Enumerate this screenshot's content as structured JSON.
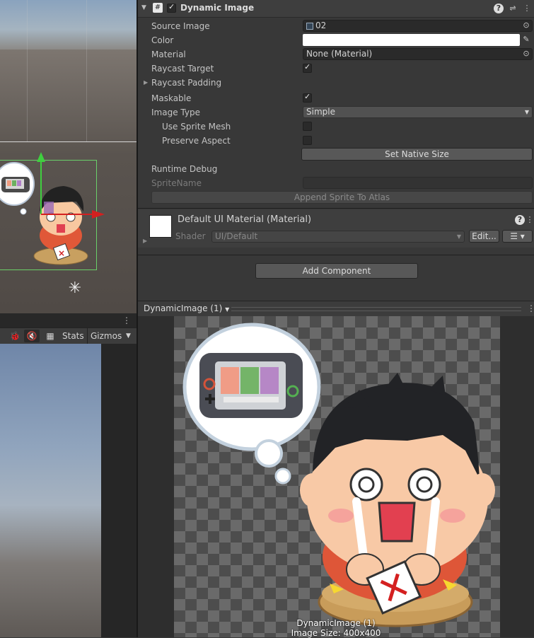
{
  "scene": {
    "icons": {
      "move_handle": "move-gizmo-icon",
      "rect_tool": "rect-tool-icon"
    }
  },
  "game_toolbar": {
    "stats_label": "Stats",
    "gizmos_label": "Gizmos",
    "icons": [
      "bug-icon",
      "mute-audio-icon",
      "grid-icon",
      "dropdown-arrow-icon"
    ]
  },
  "inspector": {
    "component_title": "Dynamic Image",
    "component_enabled": true,
    "header_icons": [
      "help-icon",
      "presets-icon",
      "more-icon"
    ],
    "rows": {
      "source_image": {
        "label": "Source Image",
        "value": "02"
      },
      "color": {
        "label": "Color",
        "value": "#ffffff"
      },
      "material": {
        "label": "Material",
        "value": "None (Material)"
      },
      "raycast_target": {
        "label": "Raycast Target",
        "checked": true
      },
      "raycast_padding": {
        "label": "Raycast Padding"
      },
      "maskable": {
        "label": "Maskable",
        "checked": true
      },
      "image_type": {
        "label": "Image Type",
        "value": "Simple"
      },
      "use_sprite_mesh": {
        "label": "Use Sprite Mesh",
        "checked": false
      },
      "preserve_aspect": {
        "label": "Preserve Aspect",
        "checked": false
      },
      "set_native_size": {
        "label": "Set Native Size"
      },
      "runtime_debug": {
        "label": "Runtime Debug"
      },
      "sprite_name": {
        "label": "SpriteName",
        "value": ""
      },
      "append_sprite": {
        "label": "Append Sprite To Atlas"
      }
    },
    "material_block": {
      "title": "Default UI Material (Material)",
      "shader_label": "Shader",
      "shader_value": "UI/Default",
      "edit_label": "Edit...",
      "list_icon": "list-icon"
    },
    "add_component_label": "Add Component"
  },
  "preview": {
    "title": "DynamicImage (1)",
    "caption_name": "DynamicImage (1)",
    "caption_size": "Image Size: 400x400",
    "icons": [
      "dropdown-arrow-icon",
      "more-icon"
    ]
  },
  "colors": {
    "accent_check": "#e6e6e6",
    "rect_outline": "#6ad06a",
    "gizmo_x": "#d42020",
    "gizmo_y": "#3fcf3f"
  }
}
